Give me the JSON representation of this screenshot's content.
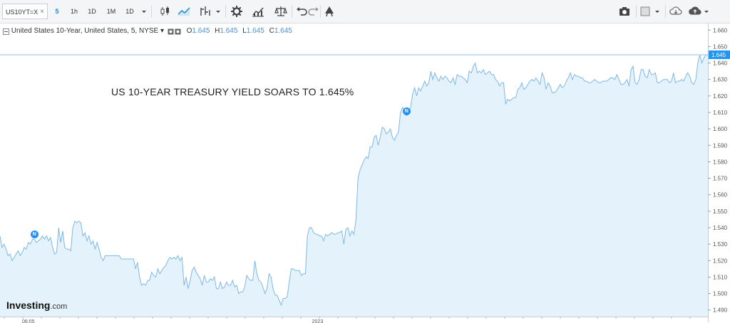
{
  "toolbar": {
    "symbol": "US10YT=X",
    "symbol_clear": "×",
    "intervals": [
      "5",
      "1h",
      "1D",
      "1M",
      "1D"
    ],
    "active_interval": "5"
  },
  "legend": {
    "title": "United States 10-Year, United States, 5, NYSE",
    "dropdown": "▾",
    "open_key": "O",
    "open": "1.645",
    "high_key": "H",
    "high": "1.645",
    "low_key": "L",
    "low": "1.645",
    "close_key": "C",
    "close": "1.645"
  },
  "headline": "US 10-YEAR TREASURY YIELD SOARS TO 1.645%",
  "brand": {
    "name": "Investing",
    "domain": ".com"
  },
  "news_markers": [
    {
      "label": "N",
      "index": 17
    },
    {
      "label": "N",
      "index": 201
    }
  ],
  "colors": {
    "line": "#7fb8e6",
    "fill": "#e4f2fb",
    "accent": "#1c88d1",
    "price_label": "#2196f3"
  },
  "chart_data": {
    "type": "area",
    "title": "",
    "xlabel": "",
    "ylabel": "",
    "x_tick_labels": [
      {
        "label": "06:05",
        "index": 14
      },
      {
        "label": "2023",
        "index": 157
      }
    ],
    "y_ticks": [
      "1.490",
      "1.500",
      "1.510",
      "1.520",
      "1.530",
      "1.540",
      "1.550",
      "1.560",
      "1.570",
      "1.580",
      "1.590",
      "1.600",
      "1.610",
      "1.620",
      "1.630",
      "1.640",
      "1.650",
      "1.660"
    ],
    "ylim": [
      1.486,
      1.664
    ],
    "last_price": "1.645",
    "grid": false,
    "values": [
      1.535,
      1.528,
      1.53,
      1.527,
      1.523,
      1.524,
      1.52,
      1.522,
      1.524,
      1.526,
      1.523,
      1.525,
      1.528,
      1.527,
      1.531,
      1.53,
      1.533,
      1.533,
      1.531,
      1.532,
      1.533,
      1.535,
      1.533,
      1.535,
      1.532,
      1.534,
      1.528,
      1.524,
      1.525,
      1.54,
      1.531,
      1.538,
      1.528,
      1.527,
      1.527,
      1.526,
      1.54,
      1.544,
      1.543,
      1.544,
      1.543,
      1.535,
      1.537,
      1.532,
      1.535,
      1.53,
      1.532,
      1.527,
      1.531,
      1.527,
      1.522,
      1.52,
      1.523,
      1.523,
      1.523,
      1.523,
      1.523,
      1.523,
      1.523,
      1.523,
      1.521,
      1.521,
      1.521,
      1.521,
      1.521,
      1.521,
      1.521,
      1.515,
      1.519,
      1.51,
      1.505,
      1.506,
      1.505,
      1.508,
      1.508,
      1.513,
      1.511,
      1.51,
      1.515,
      1.512,
      1.514,
      1.516,
      1.517,
      1.52,
      1.522,
      1.521,
      1.522,
      1.521,
      1.523,
      1.52,
      1.522,
      1.505,
      1.51,
      1.503,
      1.508,
      1.514,
      1.516,
      1.513,
      1.511,
      1.509,
      1.505,
      1.511,
      1.507,
      1.507,
      1.509,
      1.508,
      1.51,
      1.503,
      1.503,
      1.507,
      1.503,
      1.504,
      1.507,
      1.505,
      1.505,
      1.508,
      1.504,
      1.505,
      1.5,
      1.501,
      1.501,
      1.504,
      1.511,
      1.509,
      1.508,
      1.508,
      1.52,
      1.512,
      1.508,
      1.507,
      1.504,
      1.5,
      1.503,
      1.512,
      1.51,
      1.503,
      1.499,
      1.499,
      1.496,
      1.493,
      1.497,
      1.497,
      1.498,
      1.507,
      1.515,
      1.515,
      1.514,
      1.514,
      1.514,
      1.511,
      1.512,
      1.512,
      1.535,
      1.54,
      1.54,
      1.537,
      1.536,
      1.536,
      1.535,
      1.535,
      1.532,
      1.536,
      1.535,
      1.536,
      1.537,
      1.536,
      1.536,
      1.537,
      1.537,
      1.538,
      1.53,
      1.539,
      1.54,
      1.535,
      1.538,
      1.536,
      1.545,
      1.57,
      1.575,
      1.578,
      1.581,
      1.583,
      1.582,
      1.589,
      1.589,
      1.595,
      1.596,
      1.59,
      1.595,
      1.601,
      1.6,
      1.597,
      1.598,
      1.6,
      1.595,
      1.593,
      1.596,
      1.598,
      1.61,
      1.613,
      1.612,
      1.608,
      1.61,
      1.613,
      1.621,
      1.625,
      1.62,
      1.625,
      1.623,
      1.626,
      1.629,
      1.626,
      1.628,
      1.635,
      1.63,
      1.634,
      1.631,
      1.629,
      1.632,
      1.63,
      1.632,
      1.631,
      1.629,
      1.628,
      1.631,
      1.627,
      1.633,
      1.632,
      1.632,
      1.631,
      1.63,
      1.628,
      1.635,
      1.634,
      1.638,
      1.64,
      1.634,
      1.635,
      1.634,
      1.636,
      1.633,
      1.634,
      1.635,
      1.633,
      1.633,
      1.63,
      1.629,
      1.626,
      1.628,
      1.628,
      1.615,
      1.618,
      1.617,
      1.618,
      1.619,
      1.619,
      1.624,
      1.625,
      1.628,
      1.624,
      1.625,
      1.627,
      1.629,
      1.63,
      1.629,
      1.631,
      1.629,
      1.627,
      1.634,
      1.631,
      1.624,
      1.628,
      1.626,
      1.622,
      1.622,
      1.623,
      1.625,
      1.627,
      1.625,
      1.626,
      1.629,
      1.631,
      1.634,
      1.63,
      1.633,
      1.632,
      1.632,
      1.631,
      1.631,
      1.629,
      1.629,
      1.628,
      1.628,
      1.629,
      1.63,
      1.629,
      1.628,
      1.628,
      1.629,
      1.629,
      1.629,
      1.63,
      1.631,
      1.631,
      1.63,
      1.633,
      1.63,
      1.627,
      1.627,
      1.628,
      1.63,
      1.626,
      1.636,
      1.638,
      1.628,
      1.627,
      1.63,
      1.636,
      1.636,
      1.632,
      1.631,
      1.636,
      1.633,
      1.633,
      1.634,
      1.628,
      1.628,
      1.629,
      1.63,
      1.63,
      1.63,
      1.628,
      1.629,
      1.634,
      1.628,
      1.629,
      1.629,
      1.63,
      1.629,
      1.632,
      1.634,
      1.632,
      1.628,
      1.627,
      1.63,
      1.64,
      1.645,
      1.64,
      1.643,
      1.645,
      1.645
    ]
  }
}
